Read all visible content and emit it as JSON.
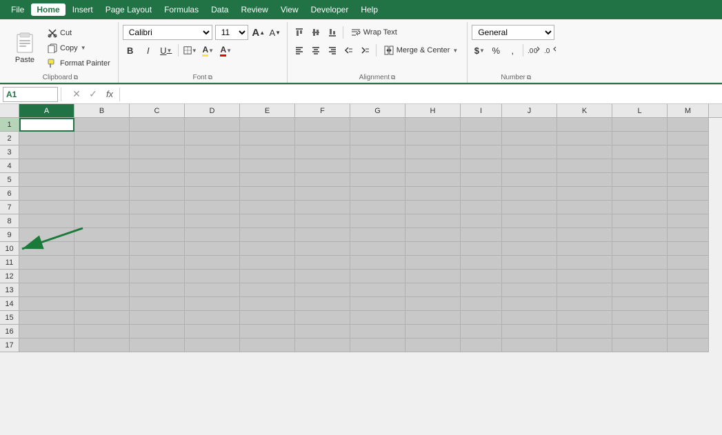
{
  "menu": {
    "items": [
      "File",
      "Home",
      "Insert",
      "Page Layout",
      "Formulas",
      "Data",
      "Review",
      "View",
      "Developer",
      "Help"
    ],
    "active": "Home"
  },
  "ribbon": {
    "clipboard": {
      "label": "Clipboard",
      "paste_label": "Paste",
      "cut_label": "Cut",
      "copy_label": "Copy",
      "format_painter_label": "Format Painter"
    },
    "font": {
      "label": "Font",
      "font_name": "Calibri",
      "font_size": "11",
      "bold": "B",
      "italic": "I",
      "underline": "U",
      "increase_font": "A",
      "decrease_font": "A"
    },
    "alignment": {
      "label": "Alignment",
      "wrap_text": "Wrap Text",
      "merge_center": "Merge & Center"
    },
    "number": {
      "label": "Number",
      "format": "General"
    }
  },
  "formula_bar": {
    "cell_ref": "A1",
    "cancel_symbol": "✕",
    "confirm_symbol": "✓",
    "fx_symbol": "fx",
    "formula_value": ""
  },
  "spreadsheet": {
    "columns": [
      "A",
      "B",
      "C",
      "D",
      "E",
      "F",
      "G",
      "H",
      "I",
      "J",
      "K",
      "L",
      "M"
    ],
    "rows": [
      1,
      2,
      3,
      4,
      5,
      6,
      7,
      8,
      9,
      10,
      11,
      12,
      13,
      14,
      15,
      16,
      17
    ],
    "active_cell": "A1"
  },
  "colors": {
    "excel_green": "#217346",
    "ribbon_bg": "#f8f8f8",
    "cell_bg": "#c8c8c8",
    "active_cell": "white",
    "header_bg": "#e8e8e8"
  }
}
